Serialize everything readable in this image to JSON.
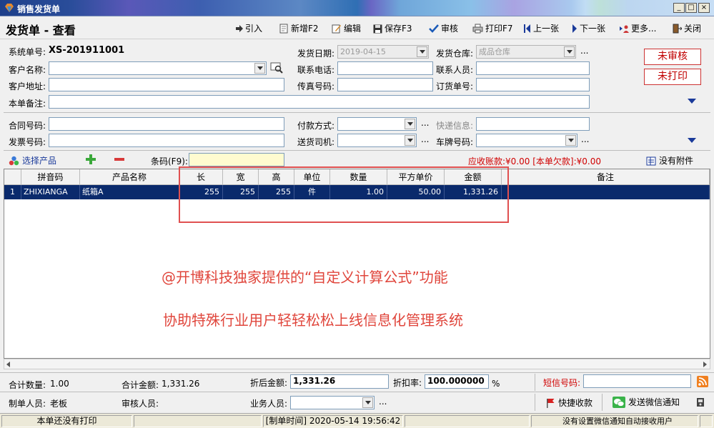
{
  "window": {
    "title": "销售发货单",
    "btn_min": "_",
    "btn_max": "□",
    "btn_close": "×"
  },
  "page_title": "发货单 - 查看",
  "toolbar": {
    "import": "引入",
    "new": "新增F2",
    "edit": "编辑",
    "save": "保存F3",
    "audit": "审核",
    "print": "打印F7",
    "prev": "上一张",
    "next": "下一张",
    "more": "更多...",
    "close": "关闭"
  },
  "header": {
    "system_no_label": "系统单号:",
    "system_no": "XS-201911001",
    "ship_date_label": "发货日期:",
    "ship_date": "2019-04-15",
    "warehouse_label": "发货仓库:",
    "warehouse": "成品仓库",
    "customer_label": "客户名称:",
    "customer": "",
    "contact_phone_label": "联系电话:",
    "contact_phone": "",
    "contact_person_label": "联系人员:",
    "contact_person": "",
    "address_label": "客户地址:",
    "address": "",
    "fax_label": "传真号码:",
    "fax": "",
    "order_no_label": "订货单号:",
    "order_no": "",
    "remark_label": "本单备注:",
    "remark": "",
    "contract_label": "合同号码:",
    "contract": "",
    "payment_label": "付款方式:",
    "payment": "",
    "express_label": "快递信息:",
    "express": "",
    "invoice_label": "发票号码:",
    "invoice": "",
    "driver_label": "送货司机:",
    "driver": "",
    "plate_label": "车牌号码:",
    "plate": "",
    "dots": "..."
  },
  "status": {
    "audit": "未审核",
    "print": "未打印"
  },
  "product_bar": {
    "select": "选择产品",
    "barcode_label": "条码(F9):",
    "barcode": "",
    "receivable": "应收账款:¥0.00 [本单欠款]:¥0.00",
    "attachment": "没有附件"
  },
  "grid": {
    "columns": [
      "拼音码",
      "产品名称",
      "长",
      "宽",
      "高",
      "单位",
      "数量",
      "平方单价",
      "金额",
      "备注"
    ],
    "rows": [
      {
        "idx": "1",
        "code": "ZHIXIANGA",
        "name": "纸箱A",
        "l": "255",
        "w": "255",
        "h": "255",
        "unit": "件",
        "qty": "1.00",
        "price": "50.00",
        "amount": "1,331.26",
        "remark": ""
      }
    ]
  },
  "promo": {
    "line1": "@开博科技独家提供的“自定义计算公式”功能",
    "line2": "协助特殊行业用户轻轻松松上线信息化管理系统"
  },
  "totals": {
    "qty_label": "合计数量:",
    "qty": "1.00",
    "amount_label": "合计金额:",
    "amount": "1,331.26",
    "discounted_label": "折后金额:",
    "discounted": "1,331.26",
    "rate_label": "折扣率:",
    "rate": "100.000000",
    "percent": "%",
    "sms_label": "短信号码:",
    "sms": ""
  },
  "footer": {
    "maker_label": "制单人员:",
    "maker": "老板",
    "auditor_label": "审核人员:",
    "auditor": "",
    "sales_label": "业务人员:",
    "sales": "",
    "quick_pay": "快捷收款",
    "wechat": "发送微信通知"
  },
  "statusbar": {
    "print_state": "本单还没有打印",
    "made_time": "[制单时间] 2020-05-14 19:56:42",
    "wechat_state": "没有设置微信通知自动接收用户"
  }
}
